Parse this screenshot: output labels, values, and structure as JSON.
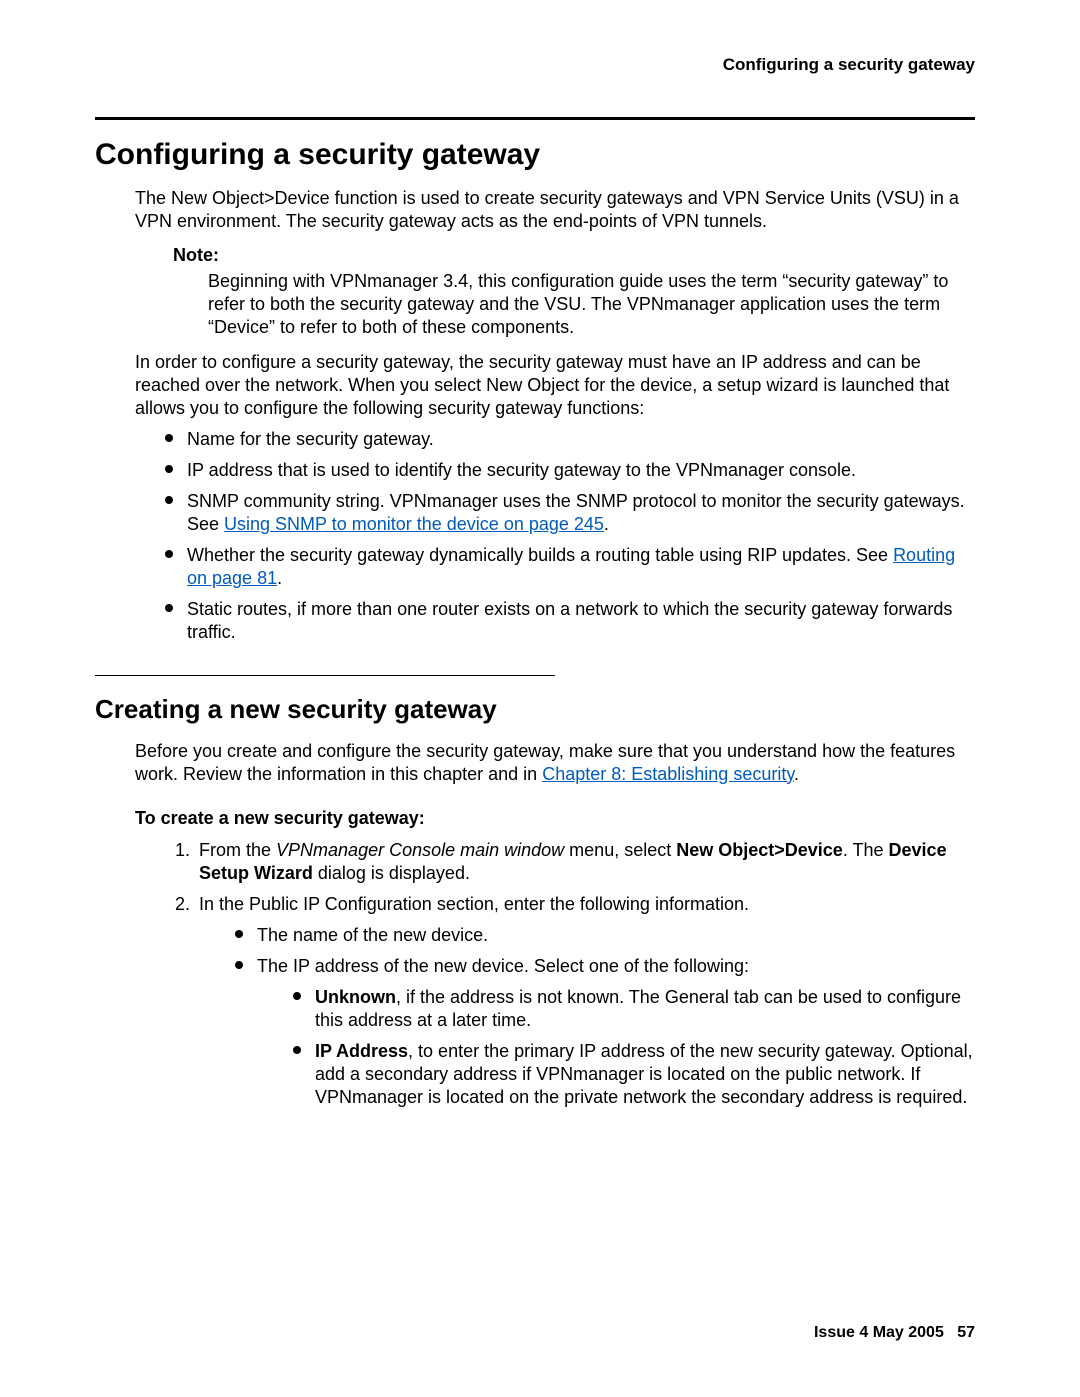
{
  "header": {
    "running_title": "Configuring a security gateway"
  },
  "section1": {
    "title": "Configuring a security gateway",
    "intro": "The New Object>Device function is used to create security gateways and VPN Service Units (VSU) in a VPN environment. The security gateway acts as the end-points of VPN tunnels.",
    "note_label": "Note:",
    "note_body": "Beginning with VPNmanager 3.4, this configuration guide uses the term “security gateway” to refer to both the security gateway and the VSU. The VPNmanager application uses the term “Device” to refer to both of these components.",
    "para2": "In order to configure a security gateway, the security gateway must have an IP address and can be reached over the network. When you select New Object for the device, a setup wizard is launched that allows you to configure the following security gateway functions:",
    "bullets": {
      "b1": "Name for the security gateway.",
      "b2": "IP address that is used to identify the security gateway to the VPNmanager console.",
      "b3_a": "SNMP community string. VPNmanager uses the SNMP protocol to monitor the security gateways. See ",
      "b3_link": "Using SNMP to monitor the device on page 245",
      "b3_b": ".",
      "b4_a": "Whether the security gateway dynamically builds a routing table using RIP updates. See ",
      "b4_link": "Routing on page 81",
      "b4_b": ".",
      "b5": "Static routes, if more than one router exists on a network to which the security gateway forwards traffic."
    }
  },
  "section2": {
    "title": "Creating a new security gateway",
    "intro_a": "Before you create and configure the security gateway, make sure that you understand how the features work. Review the information in this chapter and in ",
    "intro_link": "Chapter 8: Establishing security",
    "intro_b": ".",
    "task_title": "To create a new security gateway:",
    "step1_a": "From the ",
    "step1_em": "VPNmanager Console main window",
    "step1_b": " menu, select ",
    "step1_bold1": "New Object>Device",
    "step1_c": ". The ",
    "step1_bold2": "Device Setup Wizard",
    "step1_d": " dialog is displayed.",
    "step2": "In the Public IP Configuration section, enter the following information.",
    "step2_sub1": "The name of the new device.",
    "step2_sub2": "The IP address of the new device. Select one of the following:",
    "unknown_bold": "Unknown",
    "unknown_rest": ", if the address is not known. The General tab can be used to configure this address at a later time.",
    "ip_bold": "IP Address",
    "ip_rest": ", to enter the primary IP address of the new security gateway. Optional, add a secondary address if VPNmanager is located on the public network. If VPNmanager is located on the private network the secondary address is required."
  },
  "footer": {
    "issue": "Issue 4   May 2005",
    "page": "57"
  }
}
